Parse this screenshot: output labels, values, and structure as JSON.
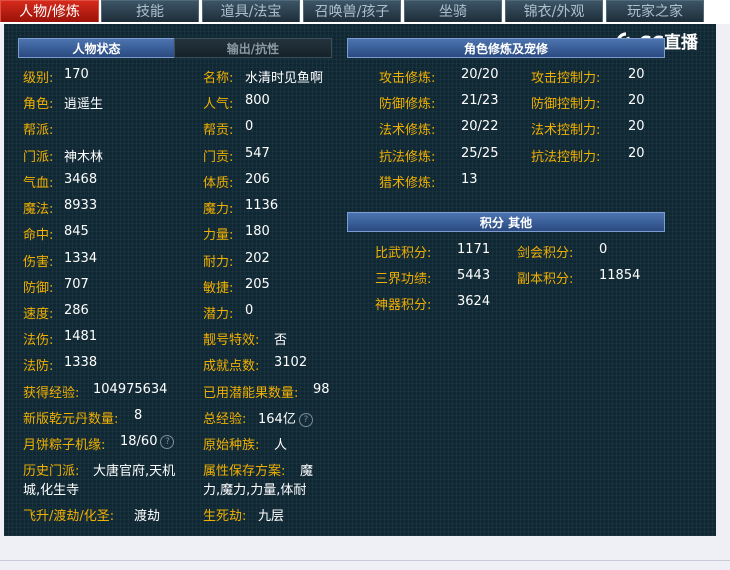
{
  "tabs": [
    "人物/修炼",
    "技能",
    "道具/法宝",
    "召唤兽/孩子",
    "坐骑",
    "锦衣/外观",
    "玩家之家"
  ],
  "logo": "CC直播",
  "status": {
    "header_active": "人物状态",
    "header_inactive": "输出/抗性",
    "left_col": [
      {
        "label": "级别:",
        "value": "170"
      },
      {
        "label": "角色:",
        "value": "逍遥生"
      },
      {
        "label": "帮派:",
        "value": ""
      },
      {
        "label": "门派:",
        "value": "神木林"
      },
      {
        "label": "气血:",
        "value": "3468"
      },
      {
        "label": "魔法:",
        "value": "8933"
      },
      {
        "label": "命中:",
        "value": "845"
      },
      {
        "label": "伤害:",
        "value": "1334"
      },
      {
        "label": "防御:",
        "value": "707"
      },
      {
        "label": "速度:",
        "value": "286"
      },
      {
        "label": "法伤:",
        "value": "1481"
      },
      {
        "label": "法防:",
        "value": "1338"
      },
      {
        "label": "获得经验:",
        "value": "104975634"
      },
      {
        "label": "新版乾元丹数量:",
        "value": "8"
      },
      {
        "label": "月饼粽子机缘:",
        "value": "18/60"
      }
    ],
    "right_col": [
      {
        "label": "名称:",
        "value": "水清时见鱼啊"
      },
      {
        "label": "人气:",
        "value": "800"
      },
      {
        "label": "帮贡:",
        "value": "0"
      },
      {
        "label": "门贡:",
        "value": "547"
      },
      {
        "label": "体质:",
        "value": "206"
      },
      {
        "label": "魔力:",
        "value": "1136"
      },
      {
        "label": "力量:",
        "value": "180"
      },
      {
        "label": "耐力:",
        "value": "202"
      },
      {
        "label": "敏捷:",
        "value": "205"
      },
      {
        "label": "潜力:",
        "value": "0"
      },
      {
        "label": "靓号特效:",
        "value": "否"
      },
      {
        "label": "成就点数:",
        "value": "3102"
      },
      {
        "label": "已用潜能果数量:",
        "value": "98"
      },
      {
        "label": "总经验:",
        "value": "164亿"
      },
      {
        "label": "原始种族:",
        "value": "人"
      }
    ],
    "history_label": "历史门派:",
    "history_line1": "大唐官府,天机",
    "history_line2": "城,化生寺",
    "attr_label": "属性保存方案:",
    "attr_line1": "魔",
    "attr_line2": "力,魔力,力量,体耐",
    "fly_label": "飞升/渡劫/化圣:",
    "fly_value": "渡劫",
    "life_label": "生死劫:",
    "life_value": "九层"
  },
  "cultivation": {
    "header": "角色修炼及宠修",
    "rows": [
      {
        "label": "攻击修炼:",
        "value": "20/20",
        "label2": "攻击控制力:",
        "value2": "20"
      },
      {
        "label": "防御修炼:",
        "value": "21/23",
        "label2": "防御控制力:",
        "value2": "20"
      },
      {
        "label": "法术修炼:",
        "value": "20/22",
        "label2": "法术控制力:",
        "value2": "20"
      },
      {
        "label": "抗法修炼:",
        "value": "25/25",
        "label2": "抗法控制力:",
        "value2": "20"
      },
      {
        "label": "猎术修炼:",
        "value": "13",
        "label2": "",
        "value2": ""
      }
    ]
  },
  "points": {
    "header": "积分  其他",
    "rows": [
      {
        "label": "比武积分:",
        "value": "1171",
        "label2": "剑会积分:",
        "value2": "0"
      },
      {
        "label": "三界功绩:",
        "value": "5443",
        "label2": "副本积分:",
        "value2": "11854"
      },
      {
        "label": "神器积分:",
        "value": "3624",
        "label2": "",
        "value2": ""
      }
    ]
  }
}
